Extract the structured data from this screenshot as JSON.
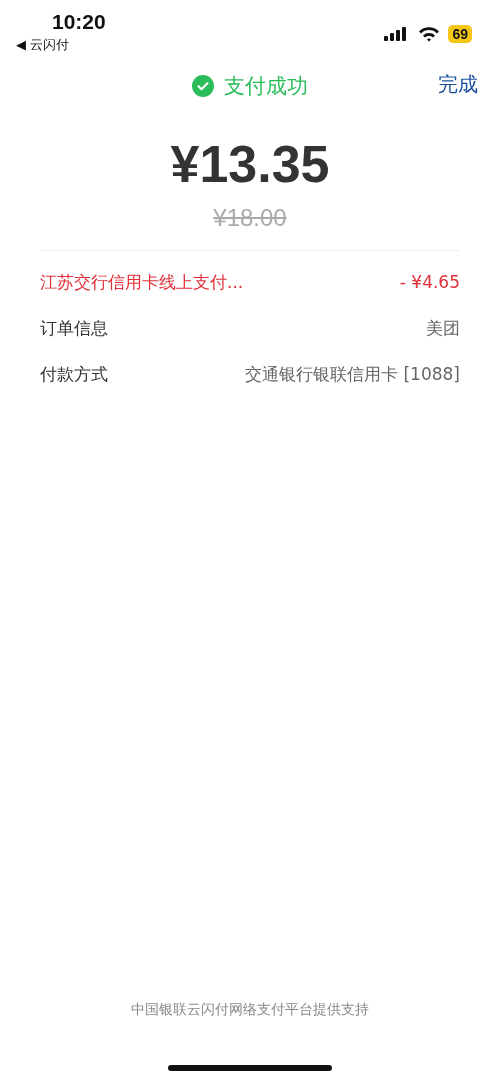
{
  "status_bar": {
    "time": "10:20",
    "back_app": "◀ 云闪付",
    "battery": "69"
  },
  "header": {
    "title": "支付成功",
    "done": "完成"
  },
  "amount": "¥13.35",
  "original_amount": "¥18.00",
  "rows": [
    {
      "kind": "discount",
      "label": "江苏交行信用卡线上支付...",
      "value": "- ¥4.65"
    },
    {
      "kind": "info",
      "label": "订单信息",
      "value": "美团"
    },
    {
      "kind": "info",
      "label": "付款方式",
      "value": "交通银行银联信用卡 [1088]"
    }
  ],
  "footer": "中国银联云闪付网络支付平台提供支持"
}
